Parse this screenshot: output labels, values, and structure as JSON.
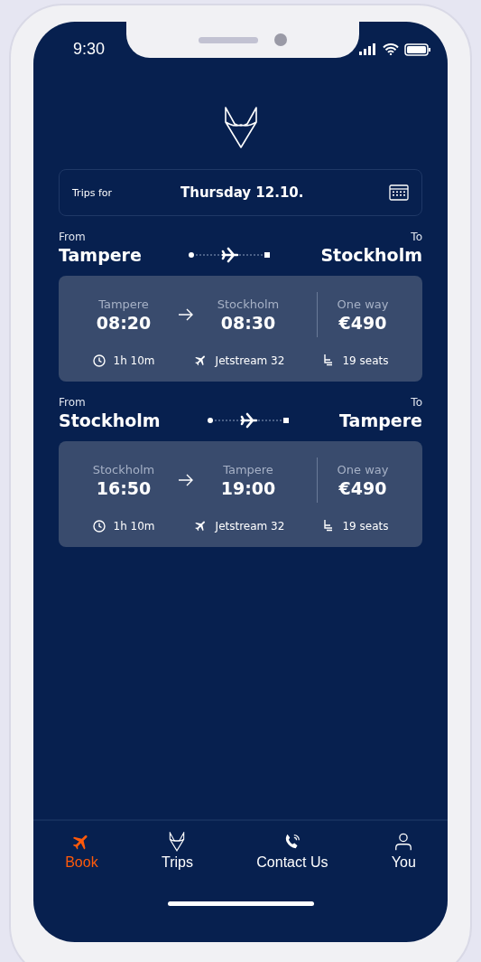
{
  "status_bar": {
    "time": "9:30"
  },
  "date_bar": {
    "label": "Trips for",
    "date": "Thursday 12.10."
  },
  "legs": [
    {
      "from_label": "From",
      "from": "Tampere",
      "to_label": "To",
      "to": "Stockholm",
      "flight": {
        "departure_city": "Tampere",
        "departure_time": "08:20",
        "arrival_city": "Stockholm",
        "arrival_time": "08:30",
        "fare_type": "One way",
        "price": "€490",
        "duration": "1h 10m",
        "aircraft": "Jetstream 32",
        "seats": "19 seats"
      }
    },
    {
      "from_label": "From",
      "from": "Stockholm",
      "to_label": "To",
      "to": "Tampere",
      "flight": {
        "departure_city": "Stockholm",
        "departure_time": "16:50",
        "arrival_city": "Tampere",
        "arrival_time": "19:00",
        "fare_type": "One way",
        "price": "€490",
        "duration": "1h 10m",
        "aircraft": "Jetstream 32",
        "seats": "19 seats"
      }
    }
  ],
  "tab_bar": [
    {
      "kind": "plane",
      "label": "Book",
      "selected": true
    },
    {
      "kind": "logo",
      "label": "Trips",
      "selected": false
    },
    {
      "kind": "phone",
      "label": "Contact Us",
      "selected": false
    },
    {
      "kind": "person",
      "label": "You",
      "selected": false
    }
  ]
}
